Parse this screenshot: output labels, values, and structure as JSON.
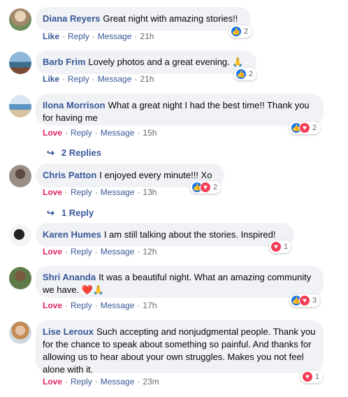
{
  "comments": [
    {
      "author": "Diana Reyers",
      "text": "Great night with amazing stories!!",
      "reaction_label": "Like",
      "reply": "Reply",
      "message": "Message",
      "time": "21h",
      "reaction_count": "2",
      "icons": [
        "like-icon"
      ]
    },
    {
      "author": "Barb Frim",
      "text": "Lovely photos and a great evening. 🙏",
      "reaction_label": "Like",
      "reply": "Reply",
      "message": "Message",
      "time": "21h",
      "reaction_count": "2",
      "icons": [
        "like-icon"
      ]
    },
    {
      "author": "Ilona Morrison",
      "text": "What a great night I had the best time!! Thank you for having me",
      "reaction_label": "Love",
      "reply": "Reply",
      "message": "Message",
      "time": "15h",
      "reaction_count": "2",
      "icons": [
        "like-icon",
        "love-icon"
      ]
    },
    {
      "author": "Chris Patton",
      "text": "I enjoyed every minute!!! Xo",
      "reaction_label": "Love",
      "reply": "Reply",
      "message": "Message",
      "time": "13h",
      "reaction_count": "2",
      "icons": [
        "like-icon",
        "love-icon"
      ]
    },
    {
      "author": "Karen Humes",
      "text": "I am still talking about the stories. Inspired!",
      "reaction_label": "Love",
      "reply": "Reply",
      "message": "Message",
      "time": "12h",
      "reaction_count": "1",
      "icons": [
        "love-icon"
      ]
    },
    {
      "author": "Shri Ananda",
      "text": "It was a beautiful night. What an amazing community we have. ❤️🙏",
      "reaction_label": "Love",
      "reply": "Reply",
      "message": "Message",
      "time": "17h",
      "reaction_count": "3",
      "icons": [
        "like-icon",
        "love-icon"
      ]
    },
    {
      "author": "Lise Leroux",
      "text": "Such accepting and nonjudgmental people. Thank you for the chance to speak about something so painful. And thanks for allowing us to hear about your own struggles. Makes you not feel alone with it.",
      "reaction_label": "Love",
      "reply": "Reply",
      "message": "Message",
      "time": "23m",
      "reaction_count": "1",
      "icons": [
        "love-icon"
      ]
    }
  ],
  "reply_links": [
    {
      "label": "2 Replies"
    },
    {
      "label": "1 Reply"
    }
  ],
  "colors": {
    "link": "#385898",
    "love": "#e0245e",
    "bubble": "#f0f2f5",
    "like_icon": "#1877f2",
    "love_icon": "#f33e58"
  }
}
